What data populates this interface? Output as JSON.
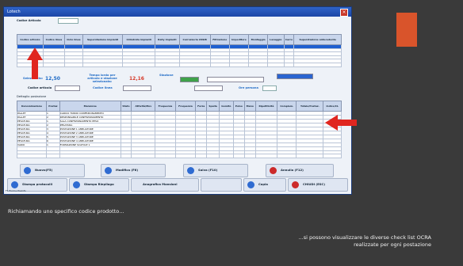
{
  "window": {
    "title": "Lotech"
  },
  "slide": {
    "accent_color": "#d9542b",
    "caption_left": "Richiamando uno specifico codice prodotto…",
    "caption_right_line1": "…si possono visualizzare le diverse check list OCRA",
    "caption_right_line2": "realizzate per ogni postazione"
  },
  "form": {
    "codice_articolo_label": "Codice Articolo",
    "selezionato_label": "Selezionato:",
    "selezionato_value": "12,50",
    "tempo_label": "Tempo lordo per articolo e stazione selezionata:",
    "tempo_value": "12,16",
    "stazione_label": "Stazione",
    "codice_articolo_row_label": "Codice articolo",
    "codice_linea_label": "Codice linea",
    "ore_persona_label": "Ore persona"
  },
  "top_grid": {
    "headers": [
      "Codice articolo",
      "Codice linea",
      "Ciclo linea",
      "Superstazione impianti",
      "Cilindrata impianti",
      "Rally impianti",
      "Carrozzeria ASSIB",
      "Filtrazione",
      "Impeditore",
      "Montaggio",
      "Lavaggio",
      "Carro",
      "Superstazione antecedente"
    ],
    "rows": 6,
    "selected_row": 0
  },
  "lower_grid": {
    "title": "Dettaglio postazione",
    "headers": [
      "Denominazione",
      "Postaz",
      "Mansione",
      "Stato",
      "Attività/Mov",
      "Frequenza",
      "Frequenza",
      "Forza",
      "Spalla",
      "Gomito",
      "Polso",
      "Mano",
      "Ripetitività",
      "Complem.",
      "Totale/Postaz.",
      "Indice/CL"
    ],
    "rows": [
      [
        "PALLET",
        "1",
        "CARICO TURNO CONFEZIONAMENTO"
      ],
      [
        "PALLET",
        "2",
        "RESPONSABILE CONFEZIONAMENTO"
      ],
      [
        "PESATURA",
        "1",
        "SALA CONFEZIONAMENTO PESO"
      ],
      [
        "PESATURA",
        "2",
        "PESATURA"
      ],
      [
        "PESATURA",
        "3",
        "POSTAZIONE 1 AMPLIATORE"
      ],
      [
        "PESATURA",
        "4",
        "POSTAZIONE 2 AMPLIATORE"
      ],
      [
        "PESATURA",
        "5",
        "POSTAZIONE 3 AMPLIATORE"
      ],
      [
        "PESATURA",
        "6",
        "POSTAZIONE 4 AMPLIATORE"
      ],
      [
        "VARIO",
        "1",
        "FORMAZIONE SCATOLE 1"
      ],
      [
        "",
        "",
        ""
      ],
      [
        "",
        "",
        ""
      ],
      [
        "",
        "",
        ""
      ]
    ]
  },
  "buttons": {
    "nuovo": "Nuovo(F5)",
    "modifica": "Modifica (F6)",
    "salva": "Salva (F10)",
    "annulla": "Annulla (F12)",
    "stampa_protocolli": "Stampa protocolli",
    "stampa_riepilogo": "Stampa Riepilogo",
    "anagrafica": "Anagrafica Mansioni",
    "copia": "Copia",
    "chiudi": "CHIUDI (ESC)"
  },
  "status_bar": {
    "text": "F1:Forma PosInfo"
  }
}
